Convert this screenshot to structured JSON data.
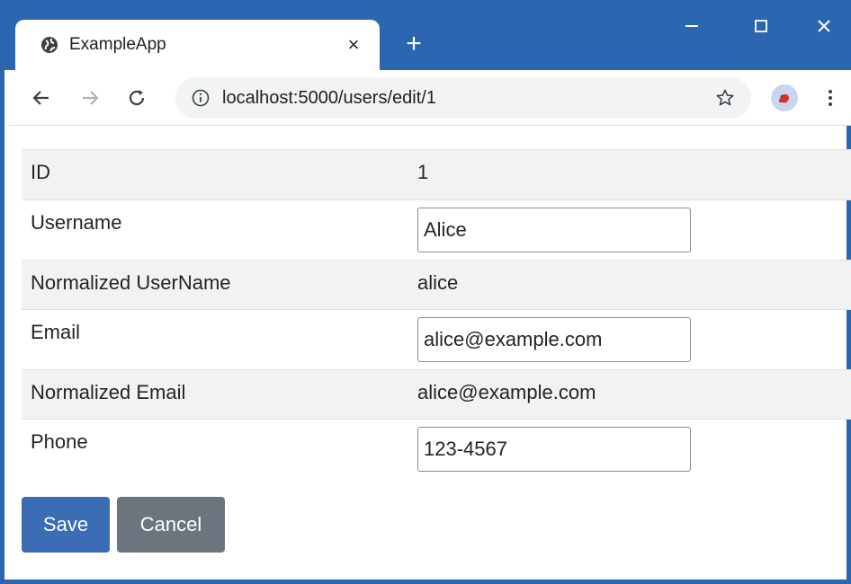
{
  "browser": {
    "tab_title": "ExampleApp",
    "tab_close_label": "×",
    "new_tab_label": "+",
    "url": "localhost:5000/users/edit/1"
  },
  "form": {
    "rows": [
      {
        "label": "ID",
        "value": "1"
      },
      {
        "label": "Username",
        "value": "Alice"
      },
      {
        "label": "Normalized UserName",
        "value": "alice"
      },
      {
        "label": "Email",
        "value": "alice@example.com"
      },
      {
        "label": "Normalized Email",
        "value": "alice@example.com"
      },
      {
        "label": "Phone",
        "value": "123-4567"
      }
    ],
    "save_label": "Save",
    "cancel_label": "Cancel"
  },
  "colors": {
    "titlebar": "#2d66b0",
    "primary_button": "#3b6db5",
    "secondary_button": "#6c757d"
  }
}
